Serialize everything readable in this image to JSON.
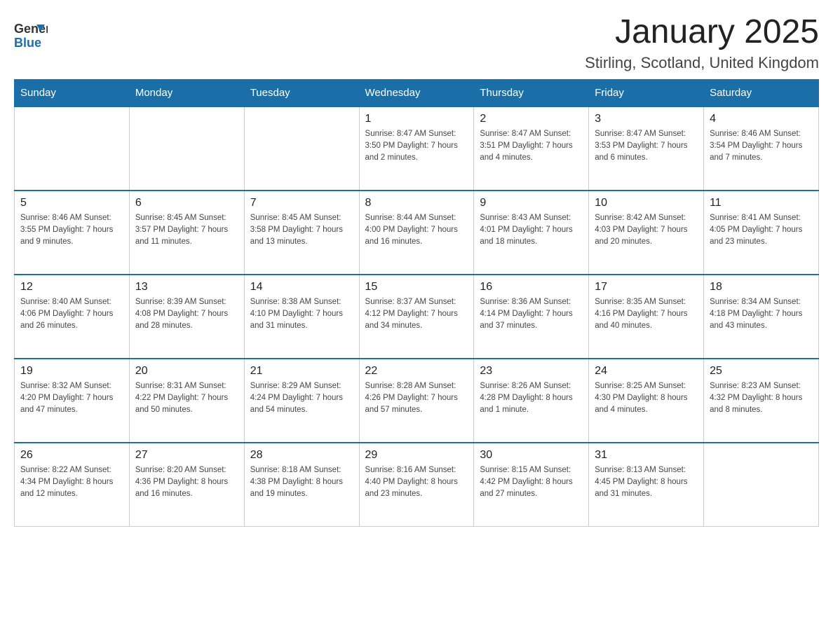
{
  "header": {
    "logo": {
      "general": "General",
      "blue": "Blue"
    },
    "title": "January 2025",
    "location": "Stirling, Scotland, United Kingdom"
  },
  "calendar": {
    "days_of_week": [
      "Sunday",
      "Monday",
      "Tuesday",
      "Wednesday",
      "Thursday",
      "Friday",
      "Saturday"
    ],
    "weeks": [
      [
        {
          "day": "",
          "info": ""
        },
        {
          "day": "",
          "info": ""
        },
        {
          "day": "",
          "info": ""
        },
        {
          "day": "1",
          "info": "Sunrise: 8:47 AM\nSunset: 3:50 PM\nDaylight: 7 hours\nand 2 minutes."
        },
        {
          "day": "2",
          "info": "Sunrise: 8:47 AM\nSunset: 3:51 PM\nDaylight: 7 hours\nand 4 minutes."
        },
        {
          "day": "3",
          "info": "Sunrise: 8:47 AM\nSunset: 3:53 PM\nDaylight: 7 hours\nand 6 minutes."
        },
        {
          "day": "4",
          "info": "Sunrise: 8:46 AM\nSunset: 3:54 PM\nDaylight: 7 hours\nand 7 minutes."
        }
      ],
      [
        {
          "day": "5",
          "info": "Sunrise: 8:46 AM\nSunset: 3:55 PM\nDaylight: 7 hours\nand 9 minutes."
        },
        {
          "day": "6",
          "info": "Sunrise: 8:45 AM\nSunset: 3:57 PM\nDaylight: 7 hours\nand 11 minutes."
        },
        {
          "day": "7",
          "info": "Sunrise: 8:45 AM\nSunset: 3:58 PM\nDaylight: 7 hours\nand 13 minutes."
        },
        {
          "day": "8",
          "info": "Sunrise: 8:44 AM\nSunset: 4:00 PM\nDaylight: 7 hours\nand 16 minutes."
        },
        {
          "day": "9",
          "info": "Sunrise: 8:43 AM\nSunset: 4:01 PM\nDaylight: 7 hours\nand 18 minutes."
        },
        {
          "day": "10",
          "info": "Sunrise: 8:42 AM\nSunset: 4:03 PM\nDaylight: 7 hours\nand 20 minutes."
        },
        {
          "day": "11",
          "info": "Sunrise: 8:41 AM\nSunset: 4:05 PM\nDaylight: 7 hours\nand 23 minutes."
        }
      ],
      [
        {
          "day": "12",
          "info": "Sunrise: 8:40 AM\nSunset: 4:06 PM\nDaylight: 7 hours\nand 26 minutes."
        },
        {
          "day": "13",
          "info": "Sunrise: 8:39 AM\nSunset: 4:08 PM\nDaylight: 7 hours\nand 28 minutes."
        },
        {
          "day": "14",
          "info": "Sunrise: 8:38 AM\nSunset: 4:10 PM\nDaylight: 7 hours\nand 31 minutes."
        },
        {
          "day": "15",
          "info": "Sunrise: 8:37 AM\nSunset: 4:12 PM\nDaylight: 7 hours\nand 34 minutes."
        },
        {
          "day": "16",
          "info": "Sunrise: 8:36 AM\nSunset: 4:14 PM\nDaylight: 7 hours\nand 37 minutes."
        },
        {
          "day": "17",
          "info": "Sunrise: 8:35 AM\nSunset: 4:16 PM\nDaylight: 7 hours\nand 40 minutes."
        },
        {
          "day": "18",
          "info": "Sunrise: 8:34 AM\nSunset: 4:18 PM\nDaylight: 7 hours\nand 43 minutes."
        }
      ],
      [
        {
          "day": "19",
          "info": "Sunrise: 8:32 AM\nSunset: 4:20 PM\nDaylight: 7 hours\nand 47 minutes."
        },
        {
          "day": "20",
          "info": "Sunrise: 8:31 AM\nSunset: 4:22 PM\nDaylight: 7 hours\nand 50 minutes."
        },
        {
          "day": "21",
          "info": "Sunrise: 8:29 AM\nSunset: 4:24 PM\nDaylight: 7 hours\nand 54 minutes."
        },
        {
          "day": "22",
          "info": "Sunrise: 8:28 AM\nSunset: 4:26 PM\nDaylight: 7 hours\nand 57 minutes."
        },
        {
          "day": "23",
          "info": "Sunrise: 8:26 AM\nSunset: 4:28 PM\nDaylight: 8 hours\nand 1 minute."
        },
        {
          "day": "24",
          "info": "Sunrise: 8:25 AM\nSunset: 4:30 PM\nDaylight: 8 hours\nand 4 minutes."
        },
        {
          "day": "25",
          "info": "Sunrise: 8:23 AM\nSunset: 4:32 PM\nDaylight: 8 hours\nand 8 minutes."
        }
      ],
      [
        {
          "day": "26",
          "info": "Sunrise: 8:22 AM\nSunset: 4:34 PM\nDaylight: 8 hours\nand 12 minutes."
        },
        {
          "day": "27",
          "info": "Sunrise: 8:20 AM\nSunset: 4:36 PM\nDaylight: 8 hours\nand 16 minutes."
        },
        {
          "day": "28",
          "info": "Sunrise: 8:18 AM\nSunset: 4:38 PM\nDaylight: 8 hours\nand 19 minutes."
        },
        {
          "day": "29",
          "info": "Sunrise: 8:16 AM\nSunset: 4:40 PM\nDaylight: 8 hours\nand 23 minutes."
        },
        {
          "day": "30",
          "info": "Sunrise: 8:15 AM\nSunset: 4:42 PM\nDaylight: 8 hours\nand 27 minutes."
        },
        {
          "day": "31",
          "info": "Sunrise: 8:13 AM\nSunset: 4:45 PM\nDaylight: 8 hours\nand 31 minutes."
        },
        {
          "day": "",
          "info": ""
        }
      ]
    ]
  }
}
